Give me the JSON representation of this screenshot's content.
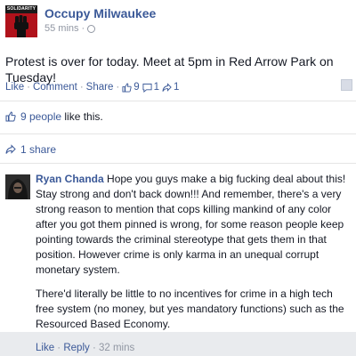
{
  "post": {
    "page_name": "Occupy Milwaukee",
    "avatar_label": "SOLIDARITY",
    "time": "55 mins",
    "meta_sep": "·",
    "text": "Protest is over for today. Meet at 5pm in Red Arrow Park on Tuesday!"
  },
  "actions": {
    "like": "Like",
    "comment": "Comment",
    "share": "Share",
    "sep": "·",
    "like_count": "9",
    "comment_count": "1",
    "share_count": "1"
  },
  "summary": {
    "likes_link": "9 people",
    "likes_rest": " like this.",
    "shares": "1 share"
  },
  "comment": {
    "author": "Ryan Chanda",
    "paragraph1": " Hope you guys make a big fucking deal about this! Stay strong and don't back down!!! And remember, there's a very strong reason to mention that cops killing mankind of any color after you got them pinned is wrong, for some reason people keep pointing towards the criminal stereotype that gets them in that position. However crime is only karma in an unequal corrupt monetary system.",
    "paragraph2": "There'd literally be little to no incentives for crime in a high tech free system (no money, but yes mandatory functions) such as the Resourced Based Economy.",
    "like": "Like",
    "reply": "Reply",
    "sep": " · ",
    "time": "32 mins"
  },
  "colors": {
    "link": "#3b5998",
    "meta": "#9197a3",
    "avatar_red": "#b0121b"
  }
}
